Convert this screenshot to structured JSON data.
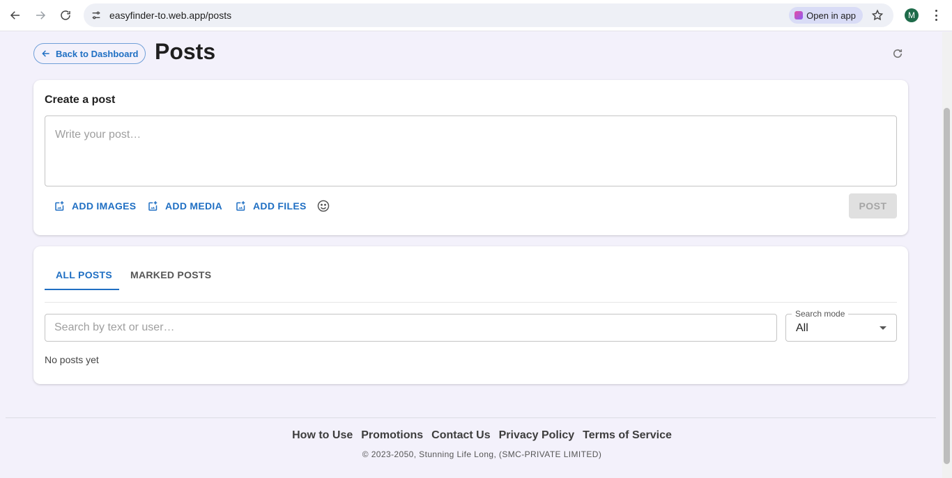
{
  "browser": {
    "url": "easyfinder-to.web.app/posts",
    "open_in_app_label": "Open in app",
    "profile_initial": "M"
  },
  "header": {
    "back_label": "Back to Dashboard",
    "title": "Posts"
  },
  "create_post": {
    "heading": "Create a post",
    "placeholder": "Write your post…",
    "add_images_label": "ADD IMAGES",
    "add_media_label": "ADD MEDIA",
    "add_files_label": "ADD FILES",
    "post_label": "POST"
  },
  "posts": {
    "tabs": [
      {
        "label": "ALL POSTS",
        "active": true
      },
      {
        "label": "MARKED POSTS",
        "active": false
      }
    ],
    "search_placeholder": "Search by text or user…",
    "search_mode_label": "Search mode",
    "search_mode_value": "All",
    "empty_text": "No posts yet"
  },
  "footer": {
    "links": [
      "How to Use",
      "Promotions",
      "Contact Us",
      "Privacy Policy",
      "Terms of Service"
    ],
    "copyright": "© 2023-2050, Stunning Life Long, (SMC-PRIVATE LIMITED)"
  },
  "colors": {
    "accent": "#1f6fc3",
    "page_bg": "#f3f1fb",
    "disabled_bg": "#e0e0e0"
  }
}
